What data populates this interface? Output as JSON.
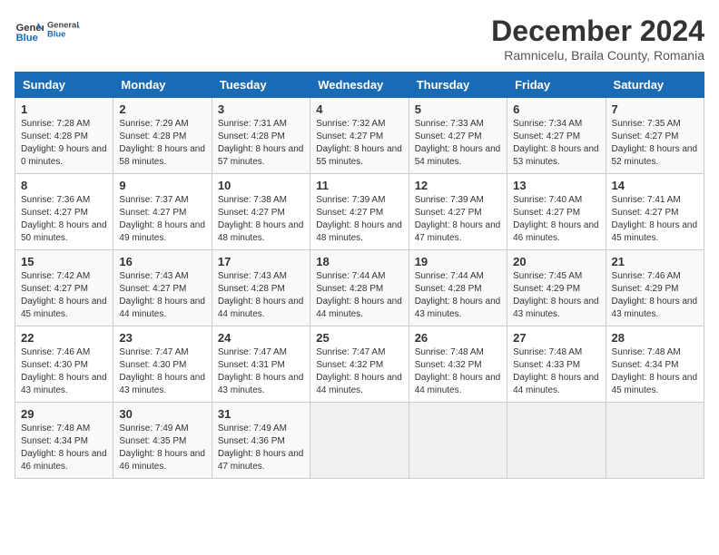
{
  "header": {
    "logo_general": "General",
    "logo_blue": "Blue",
    "title": "December 2024",
    "subtitle": "Ramnicelu, Braila County, Romania"
  },
  "calendar": {
    "days_of_week": [
      "Sunday",
      "Monday",
      "Tuesday",
      "Wednesday",
      "Thursday",
      "Friday",
      "Saturday"
    ],
    "weeks": [
      [
        {
          "day": "1",
          "sunrise": "7:28 AM",
          "sunset": "4:28 PM",
          "daylight": "9 hours and 0 minutes."
        },
        {
          "day": "2",
          "sunrise": "7:29 AM",
          "sunset": "4:28 PM",
          "daylight": "8 hours and 58 minutes."
        },
        {
          "day": "3",
          "sunrise": "7:31 AM",
          "sunset": "4:28 PM",
          "daylight": "8 hours and 57 minutes."
        },
        {
          "day": "4",
          "sunrise": "7:32 AM",
          "sunset": "4:27 PM",
          "daylight": "8 hours and 55 minutes."
        },
        {
          "day": "5",
          "sunrise": "7:33 AM",
          "sunset": "4:27 PM",
          "daylight": "8 hours and 54 minutes."
        },
        {
          "day": "6",
          "sunrise": "7:34 AM",
          "sunset": "4:27 PM",
          "daylight": "8 hours and 53 minutes."
        },
        {
          "day": "7",
          "sunrise": "7:35 AM",
          "sunset": "4:27 PM",
          "daylight": "8 hours and 52 minutes."
        }
      ],
      [
        {
          "day": "8",
          "sunrise": "7:36 AM",
          "sunset": "4:27 PM",
          "daylight": "8 hours and 50 minutes."
        },
        {
          "day": "9",
          "sunrise": "7:37 AM",
          "sunset": "4:27 PM",
          "daylight": "8 hours and 49 minutes."
        },
        {
          "day": "10",
          "sunrise": "7:38 AM",
          "sunset": "4:27 PM",
          "daylight": "8 hours and 48 minutes."
        },
        {
          "day": "11",
          "sunrise": "7:39 AM",
          "sunset": "4:27 PM",
          "daylight": "8 hours and 48 minutes."
        },
        {
          "day": "12",
          "sunrise": "7:39 AM",
          "sunset": "4:27 PM",
          "daylight": "8 hours and 47 minutes."
        },
        {
          "day": "13",
          "sunrise": "7:40 AM",
          "sunset": "4:27 PM",
          "daylight": "8 hours and 46 minutes."
        },
        {
          "day": "14",
          "sunrise": "7:41 AM",
          "sunset": "4:27 PM",
          "daylight": "8 hours and 45 minutes."
        }
      ],
      [
        {
          "day": "15",
          "sunrise": "7:42 AM",
          "sunset": "4:27 PM",
          "daylight": "8 hours and 45 minutes."
        },
        {
          "day": "16",
          "sunrise": "7:43 AM",
          "sunset": "4:27 PM",
          "daylight": "8 hours and 44 minutes."
        },
        {
          "day": "17",
          "sunrise": "7:43 AM",
          "sunset": "4:28 PM",
          "daylight": "8 hours and 44 minutes."
        },
        {
          "day": "18",
          "sunrise": "7:44 AM",
          "sunset": "4:28 PM",
          "daylight": "8 hours and 44 minutes."
        },
        {
          "day": "19",
          "sunrise": "7:44 AM",
          "sunset": "4:28 PM",
          "daylight": "8 hours and 43 minutes."
        },
        {
          "day": "20",
          "sunrise": "7:45 AM",
          "sunset": "4:29 PM",
          "daylight": "8 hours and 43 minutes."
        },
        {
          "day": "21",
          "sunrise": "7:46 AM",
          "sunset": "4:29 PM",
          "daylight": "8 hours and 43 minutes."
        }
      ],
      [
        {
          "day": "22",
          "sunrise": "7:46 AM",
          "sunset": "4:30 PM",
          "daylight": "8 hours and 43 minutes."
        },
        {
          "day": "23",
          "sunrise": "7:47 AM",
          "sunset": "4:30 PM",
          "daylight": "8 hours and 43 minutes."
        },
        {
          "day": "24",
          "sunrise": "7:47 AM",
          "sunset": "4:31 PM",
          "daylight": "8 hours and 43 minutes."
        },
        {
          "day": "25",
          "sunrise": "7:47 AM",
          "sunset": "4:32 PM",
          "daylight": "8 hours and 44 minutes."
        },
        {
          "day": "26",
          "sunrise": "7:48 AM",
          "sunset": "4:32 PM",
          "daylight": "8 hours and 44 minutes."
        },
        {
          "day": "27",
          "sunrise": "7:48 AM",
          "sunset": "4:33 PM",
          "daylight": "8 hours and 44 minutes."
        },
        {
          "day": "28",
          "sunrise": "7:48 AM",
          "sunset": "4:34 PM",
          "daylight": "8 hours and 45 minutes."
        }
      ],
      [
        {
          "day": "29",
          "sunrise": "7:48 AM",
          "sunset": "4:34 PM",
          "daylight": "8 hours and 46 minutes."
        },
        {
          "day": "30",
          "sunrise": "7:49 AM",
          "sunset": "4:35 PM",
          "daylight": "8 hours and 46 minutes."
        },
        {
          "day": "31",
          "sunrise": "7:49 AM",
          "sunset": "4:36 PM",
          "daylight": "8 hours and 47 minutes."
        },
        null,
        null,
        null,
        null
      ]
    ]
  }
}
